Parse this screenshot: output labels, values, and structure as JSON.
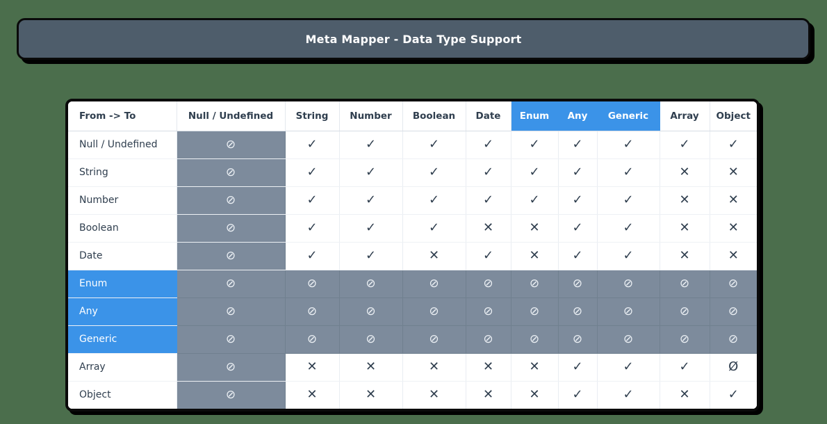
{
  "titlebar": {
    "title": "Meta Mapper - Data Type Support"
  },
  "table": {
    "corner_label": "From -> To",
    "columns": [
      {
        "label": "Null / Undefined",
        "highlight": false
      },
      {
        "label": "String",
        "highlight": false
      },
      {
        "label": "Number",
        "highlight": false
      },
      {
        "label": "Boolean",
        "highlight": false
      },
      {
        "label": "Date",
        "highlight": false
      },
      {
        "label": "Enum",
        "highlight": true
      },
      {
        "label": "Any",
        "highlight": true
      },
      {
        "label": "Generic",
        "highlight": true
      },
      {
        "label": "Array",
        "highlight": false
      },
      {
        "label": "Object",
        "highlight": false
      }
    ],
    "rows": [
      {
        "label": "Null / Undefined",
        "highlight": false,
        "cells": [
          "blocked",
          "yes",
          "yes",
          "yes",
          "yes",
          "yes",
          "yes",
          "yes",
          "yes",
          "yes"
        ]
      },
      {
        "label": "String",
        "highlight": false,
        "cells": [
          "blocked",
          "yes",
          "yes",
          "yes",
          "yes",
          "yes",
          "yes",
          "yes",
          "no",
          "no"
        ]
      },
      {
        "label": "Number",
        "highlight": false,
        "cells": [
          "blocked",
          "yes",
          "yes",
          "yes",
          "yes",
          "yes",
          "yes",
          "yes",
          "no",
          "no"
        ]
      },
      {
        "label": "Boolean",
        "highlight": false,
        "cells": [
          "blocked",
          "yes",
          "yes",
          "yes",
          "no",
          "no",
          "yes",
          "yes",
          "no",
          "no"
        ]
      },
      {
        "label": "Date",
        "highlight": false,
        "cells": [
          "blocked",
          "yes",
          "yes",
          "no",
          "yes",
          "no",
          "yes",
          "yes",
          "no",
          "no"
        ]
      },
      {
        "label": "Enum",
        "highlight": true,
        "cells": [
          "blocked",
          "blocked",
          "blocked",
          "blocked",
          "blocked",
          "blocked",
          "blocked",
          "blocked",
          "blocked",
          "blocked"
        ]
      },
      {
        "label": "Any",
        "highlight": true,
        "cells": [
          "blocked",
          "blocked",
          "blocked",
          "blocked",
          "blocked",
          "blocked",
          "blocked",
          "blocked",
          "blocked",
          "blocked"
        ]
      },
      {
        "label": "Generic",
        "highlight": true,
        "cells": [
          "blocked",
          "blocked",
          "blocked",
          "blocked",
          "blocked",
          "blocked",
          "blocked",
          "blocked",
          "blocked",
          "blocked"
        ]
      },
      {
        "label": "Array",
        "highlight": false,
        "cells": [
          "blocked",
          "no",
          "no",
          "no",
          "no",
          "no",
          "yes",
          "yes",
          "yes",
          "empty"
        ]
      },
      {
        "label": "Object",
        "highlight": false,
        "cells": [
          "blocked",
          "no",
          "no",
          "no",
          "no",
          "no",
          "yes",
          "yes",
          "no",
          "yes"
        ]
      }
    ],
    "glyphs": {
      "yes": "✓",
      "no": "✕",
      "blocked": "⊘",
      "empty": "Ø"
    }
  },
  "colors": {
    "page_background": "#4b6e4c",
    "titlebar_background": "#4e5d6b",
    "accent_blue": "#3b93e8",
    "masked_gray": "#7d8b9c",
    "text_dark": "#2f3e4e"
  }
}
